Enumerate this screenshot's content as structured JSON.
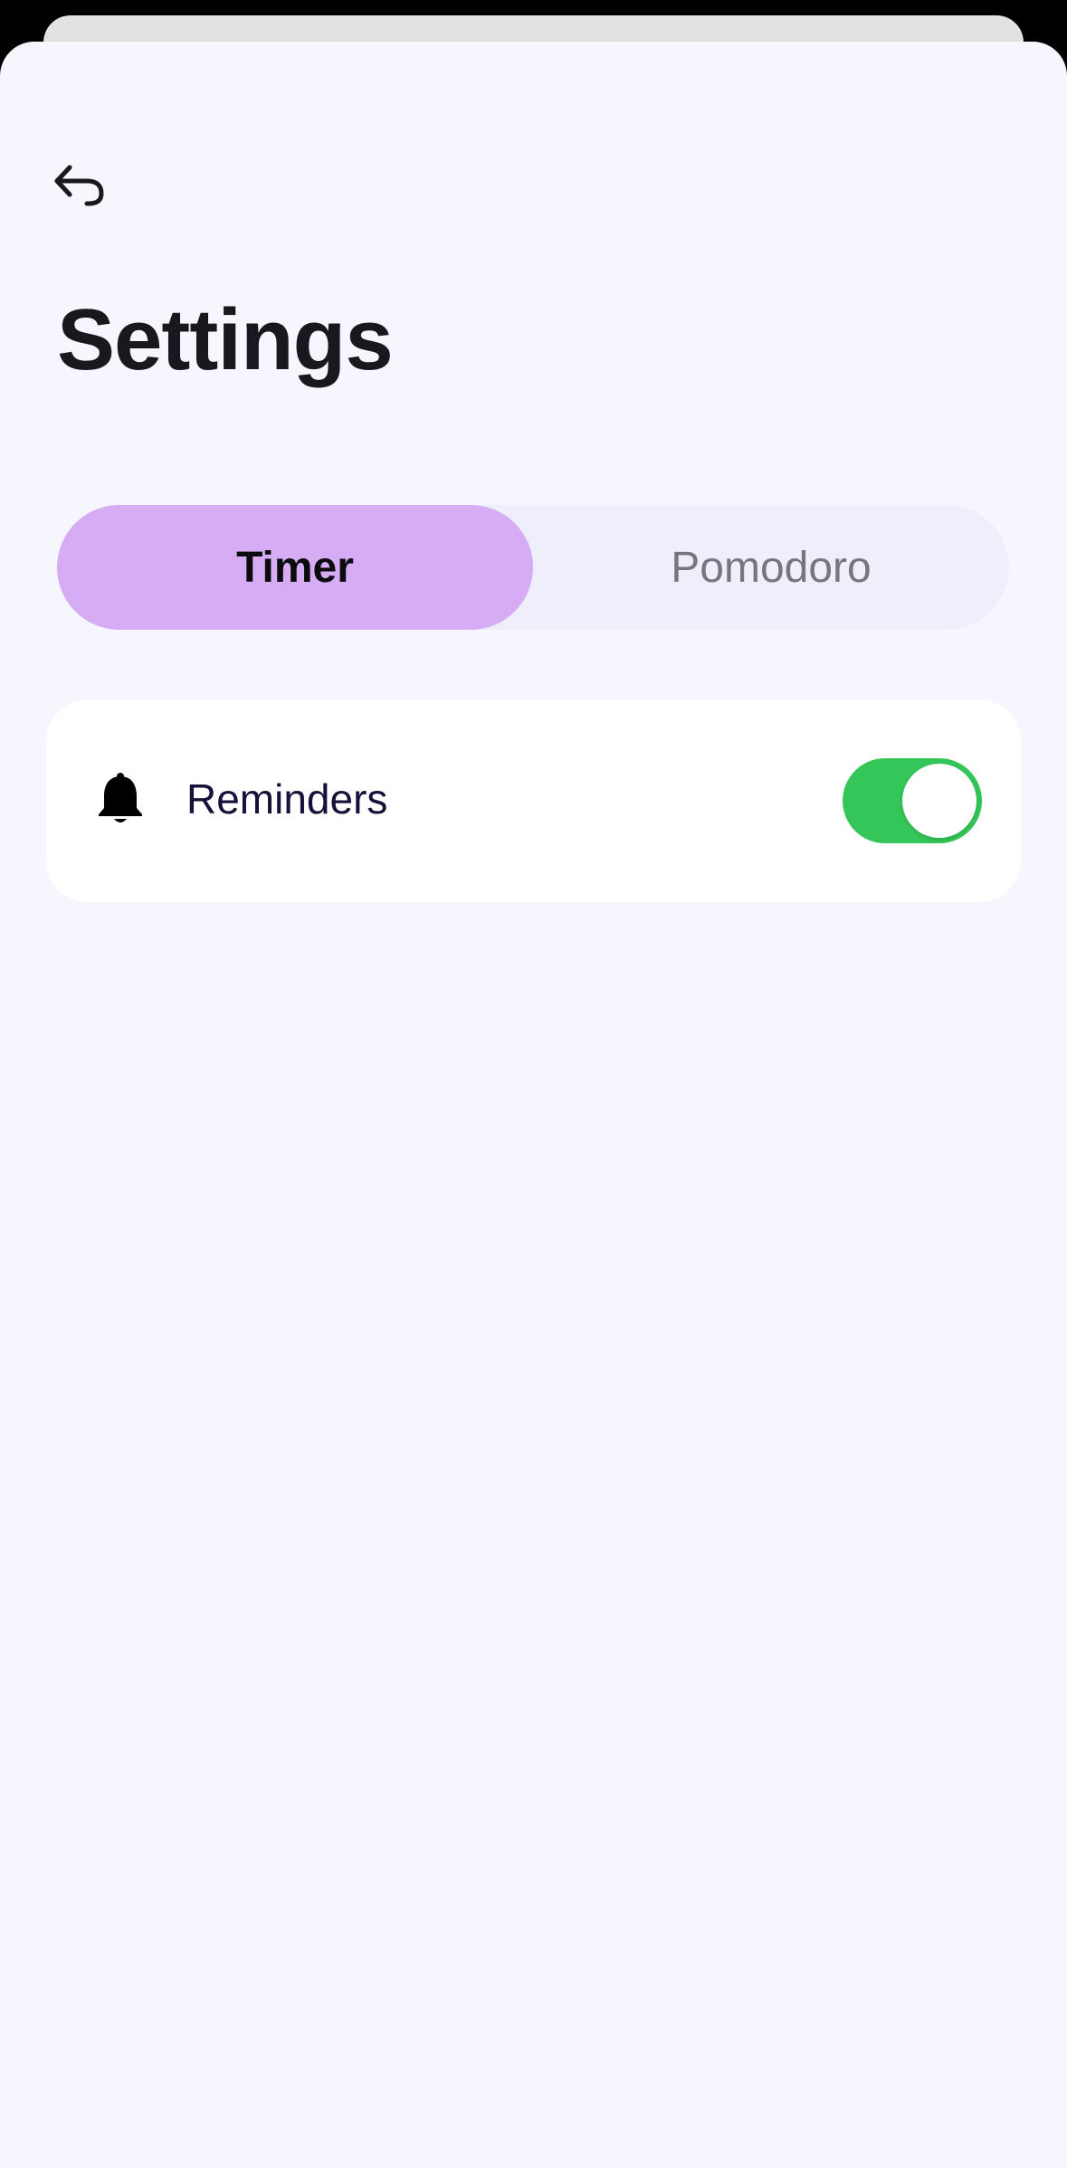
{
  "header": {
    "back_icon": "back-arrow-icon",
    "title": "Settings"
  },
  "tabs": [
    {
      "label": "Timer",
      "active": true
    },
    {
      "label": "Pomodoro",
      "active": false
    }
  ],
  "settings": {
    "reminders": {
      "icon": "bell-icon",
      "label": "Reminders",
      "enabled": true
    }
  },
  "colors": {
    "background": "#f5f6fe",
    "active_tab": "#d6acf4",
    "inactive_tab_track": "#eeeffa",
    "toggle_on": "#34c658",
    "title_text": "#18181f"
  }
}
